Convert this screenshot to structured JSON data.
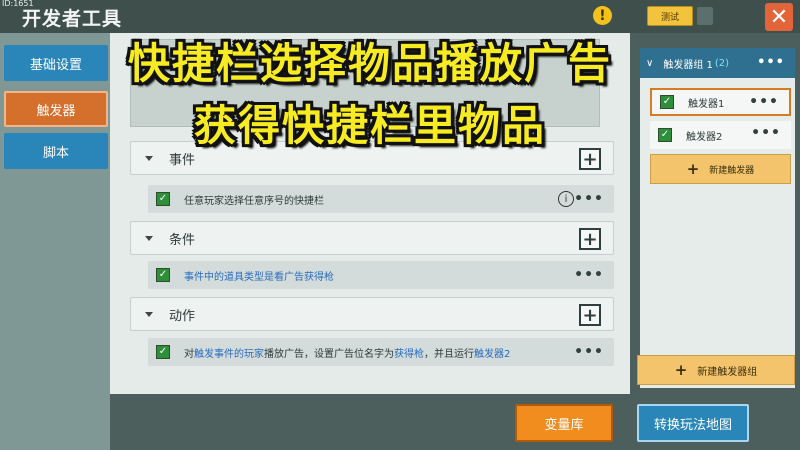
{
  "window": {
    "corner_id": "ID:1651",
    "title": "开发者工具",
    "warning_icon": "warning-icon",
    "test_label": "测试",
    "close_icon": "close-icon"
  },
  "sidebar": {
    "items": [
      {
        "label": "基础设置"
      },
      {
        "label": "触发器",
        "active": true
      },
      {
        "label": "脚本"
      }
    ]
  },
  "overlay": {
    "line1": "快捷栏选择物品播放广告",
    "line2": "获得快捷栏里物品"
  },
  "sections": [
    {
      "label": "事件",
      "rows": [
        {
          "parts": [
            {
              "text": "任意玩家选择任意序号的快捷栏",
              "hl": false
            }
          ],
          "info": true
        }
      ]
    },
    {
      "label": "条件",
      "rows": [
        {
          "parts": [
            {
              "text": "事件中的道具类型是看广告获得枪",
              "hl": true
            }
          ],
          "info": false
        }
      ]
    },
    {
      "label": "动作",
      "rows": [
        {
          "parts": [
            {
              "text": "对",
              "hl": false
            },
            {
              "text": "触发事件的玩家",
              "hl": true
            },
            {
              "text": "播放广告，设置广告位名字为",
              "hl": false
            },
            {
              "text": "获得枪",
              "hl": true
            },
            {
              "text": "，并且运行",
              "hl": false
            },
            {
              "text": "触发器2",
              "hl": true
            }
          ],
          "info": false
        }
      ]
    }
  ],
  "right_panel": {
    "group_label": "触发器组 1",
    "group_count": "(2)",
    "triggers": [
      {
        "label": "触发器1",
        "active": true
      },
      {
        "label": "触发器2",
        "active": false
      }
    ],
    "new_trigger": "新建触发器",
    "new_group": "新建触发器组"
  },
  "buttons": {
    "variables": "变量库",
    "switch_map": "转换玩法地图"
  },
  "glyphs": {
    "more": "•••",
    "plus": "+",
    "info": "i",
    "check": "✓",
    "chevron": "∨"
  },
  "colors": {
    "accent_orange": "#d4702c",
    "accent_blue": "#2a86b8",
    "overlay_text": "#f7ec22",
    "highlight_text": "#2a6bbd"
  }
}
